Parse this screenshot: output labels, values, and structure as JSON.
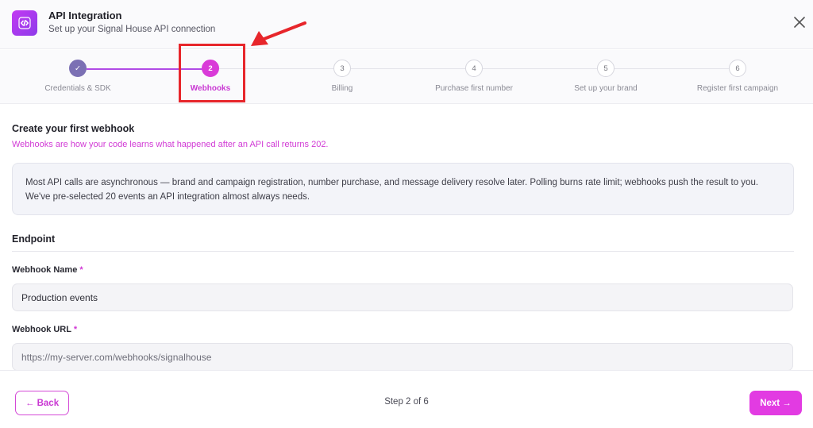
{
  "header": {
    "title": "API Integration",
    "subtitle": "Set up your Signal House API connection",
    "icon": "code-icon"
  },
  "stepper": {
    "steps": [
      {
        "number": "✓",
        "label": "Credentials & SDK",
        "state": "complete"
      },
      {
        "number": "2",
        "label": "Webhooks",
        "state": "active"
      },
      {
        "number": "3",
        "label": "Billing",
        "state": "pending"
      },
      {
        "number": "4",
        "label": "Purchase first number",
        "state": "pending"
      },
      {
        "number": "5",
        "label": "Set up your brand",
        "state": "pending"
      },
      {
        "number": "6",
        "label": "Register first campaign",
        "state": "pending"
      }
    ]
  },
  "content": {
    "title": "Create your first webhook",
    "subtitle": "Webhooks are how your code learns what happened after an API call returns 202.",
    "info": "Most API calls are asynchronous — brand and campaign registration, number purchase, and message delivery resolve later. Polling burns rate limit; webhooks push the result to you. We've pre-selected 20 events an API integration almost always needs.",
    "endpoint_title": "Endpoint",
    "webhook_name": {
      "label": "Webhook Name",
      "required": "*",
      "value": "Production events"
    },
    "webhook_url": {
      "label": "Webhook URL",
      "required": "*",
      "placeholder": "https://my-server.com/webhooks/signalhouse"
    }
  },
  "footer": {
    "back_label": "← Back",
    "step_count": "Step 2 of 6",
    "next_label": "Next →"
  },
  "colors": {
    "accent": "#e23be2",
    "complete": "#7b70b4",
    "annotation": "#e7262b"
  }
}
